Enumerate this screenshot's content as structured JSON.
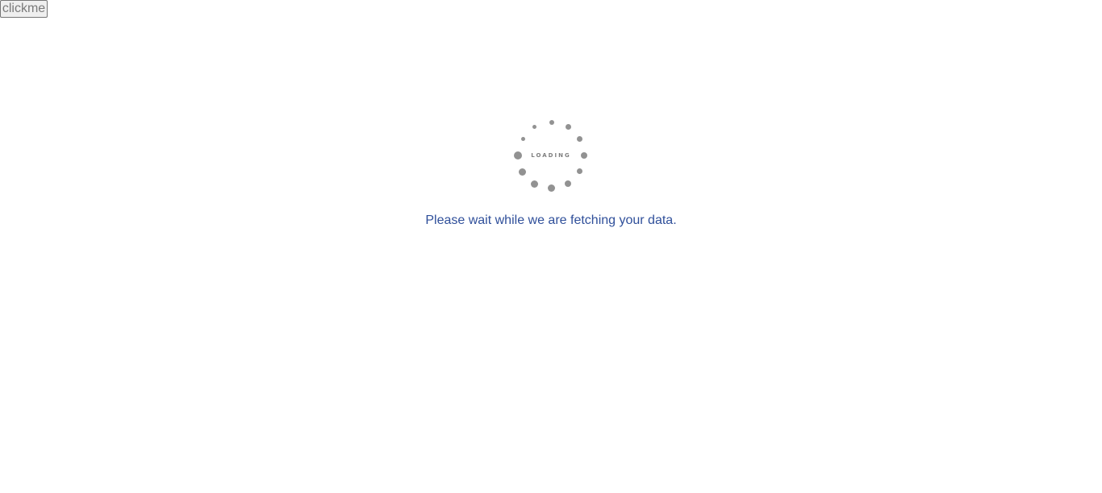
{
  "button": {
    "label": "clickme"
  },
  "loader": {
    "text": "LOADING",
    "icon": "spinner-icon",
    "dot_color": "#929292"
  },
  "message": {
    "text": "Please wait while we are fetching your data.",
    "color": "#2f4f9a"
  }
}
